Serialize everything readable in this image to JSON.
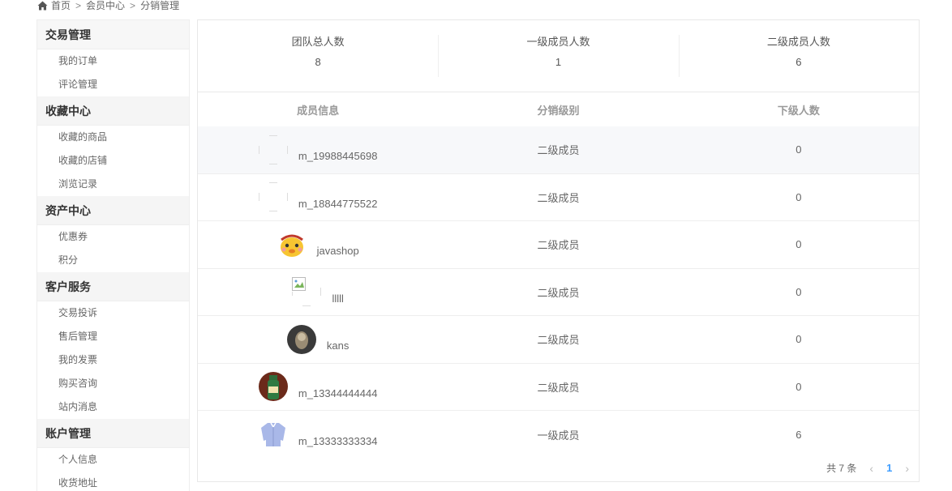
{
  "breadcrumb": {
    "home": "首页",
    "level1": "会员中心",
    "level2": "分销管理"
  },
  "sidebar": {
    "groups": [
      {
        "title": "交易管理",
        "items": [
          "我的订单",
          "评论管理"
        ]
      },
      {
        "title": "收藏中心",
        "items": [
          "收藏的商品",
          "收藏的店铺",
          "浏览记录"
        ]
      },
      {
        "title": "资产中心",
        "items": [
          "优惠券",
          "积分"
        ]
      },
      {
        "title": "客户服务",
        "items": [
          "交易投诉",
          "售后管理",
          "我的发票",
          "购买咨询",
          "站内消息"
        ]
      },
      {
        "title": "账户管理",
        "items": [
          "个人信息",
          "收货地址"
        ]
      }
    ]
  },
  "stats": [
    {
      "label": "团队总人数",
      "value": "8"
    },
    {
      "label": "一级成员人数",
      "value": "1"
    },
    {
      "label": "二级成员人数",
      "value": "6"
    }
  ],
  "table": {
    "headers": [
      "成员信息",
      "分销级别",
      "下级人数"
    ],
    "rows": [
      {
        "name": "m_19988445698",
        "level": "二级成员",
        "count": "0",
        "avatar": "empty"
      },
      {
        "name": "m_18844775522",
        "level": "二级成员",
        "count": "0",
        "avatar": "empty"
      },
      {
        "name": "javashop",
        "level": "二级成员",
        "count": "0",
        "avatar": "cartoon"
      },
      {
        "name": "lllll",
        "level": "二级成员",
        "count": "0",
        "avatar": "broken"
      },
      {
        "name": "kans",
        "level": "二级成员",
        "count": "0",
        "avatar": "dark"
      },
      {
        "name": "m_13344444444",
        "level": "二级成员",
        "count": "0",
        "avatar": "bottle"
      },
      {
        "name": "m_13333333334",
        "level": "一级成员",
        "count": "6",
        "avatar": "shirt"
      }
    ]
  },
  "pagination": {
    "total": "共 7 条",
    "current": "1"
  },
  "colors": {
    "accent": "#409eff",
    "highlight_row": "#f7f8fa"
  }
}
